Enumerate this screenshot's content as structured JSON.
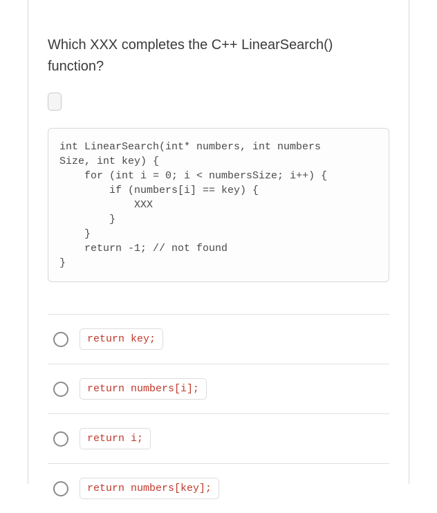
{
  "question": "Which XXX completes the C++ LinearSearch() function?",
  "code": "int LinearSearch(int* numbers, int numbers\nSize, int key) {\n    for (int i = 0; i < numbersSize; i++) {\n        if (numbers[i] == key) {\n            XXX\n        }\n    }\n    return -1; // not found\n}",
  "options": [
    {
      "label": "return key;"
    },
    {
      "label": "return numbers[i];"
    },
    {
      "label": "return i;"
    },
    {
      "label": "return numbers[key];"
    }
  ]
}
